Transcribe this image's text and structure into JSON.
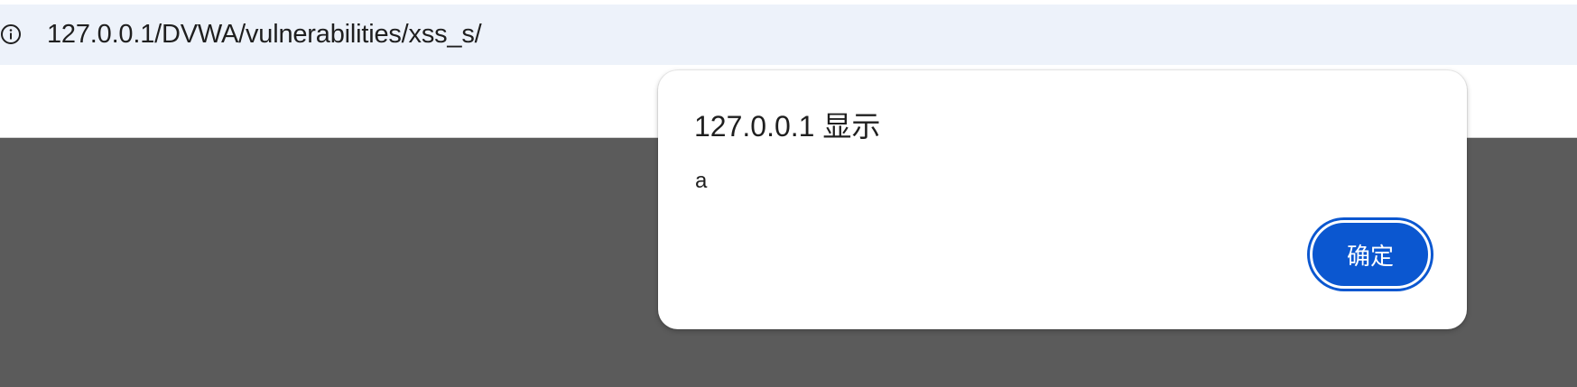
{
  "address_bar": {
    "url": "127.0.0.1/DVWA/vulnerabilities/xss_s/",
    "icon": "info-icon"
  },
  "alert_dialog": {
    "title": "127.0.0.1 显示",
    "message": "a",
    "ok_label": "确定"
  },
  "colors": {
    "omnibox_bg": "#edf2fa",
    "page_overlay": "#5b5b5b",
    "button_blue": "#0b57d0"
  }
}
